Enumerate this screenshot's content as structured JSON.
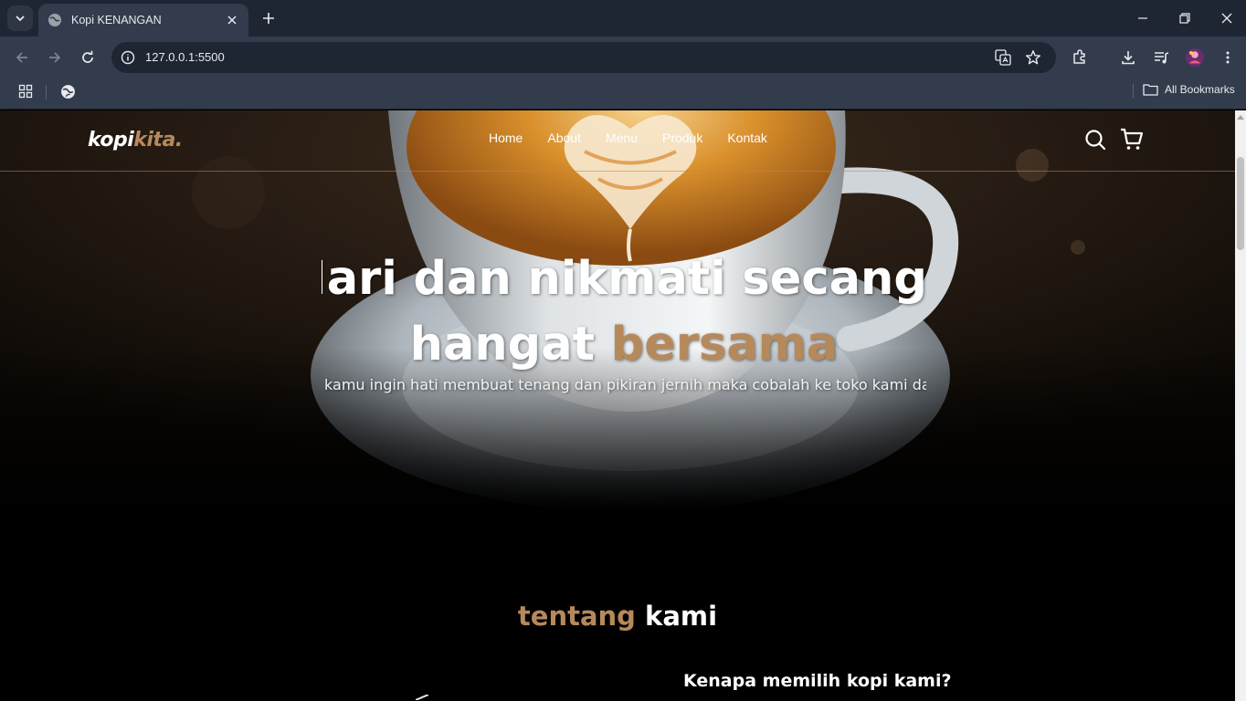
{
  "browser": {
    "tab_title": "Kopi KENANGAN",
    "url": "127.0.0.1:5500",
    "all_bookmarks_label": "All Bookmarks"
  },
  "colors": {
    "accent": "#b6895b",
    "chrome_dark": "#1f2633",
    "chrome": "#323c4c"
  },
  "icons": [
    "tab-search-icon",
    "globe-icon",
    "close-icon",
    "plus-icon",
    "minimize-icon",
    "restore-icon",
    "back-icon",
    "forward-icon",
    "reload-icon",
    "info-icon",
    "translate-icon",
    "star-icon",
    "extensions-icon",
    "download-icon",
    "media-icon",
    "profile-avatar",
    "more-icon",
    "apps-icon",
    "folder-icon",
    "search-icon",
    "cart-icon"
  ],
  "site": {
    "logo": {
      "part1": "kopi",
      "part2": "kita."
    },
    "nav": [
      "Home",
      "About",
      "Menu",
      "Produk",
      "Kontak"
    ],
    "hero": {
      "line1": "Mari dan nikmati secangkir kopi",
      "line2_start": "hangat",
      "line2_accent": "bersama",
      "subtitle": "Jika kamu ingin hati membuat tenang dan pikiran jernih maka cobalah ke toko kami dan nikmati kopi dari kami"
    },
    "about": {
      "title_accent": "tentang",
      "title_rest": "kami",
      "subheading": "Kenapa memilih kopi kami?"
    }
  }
}
